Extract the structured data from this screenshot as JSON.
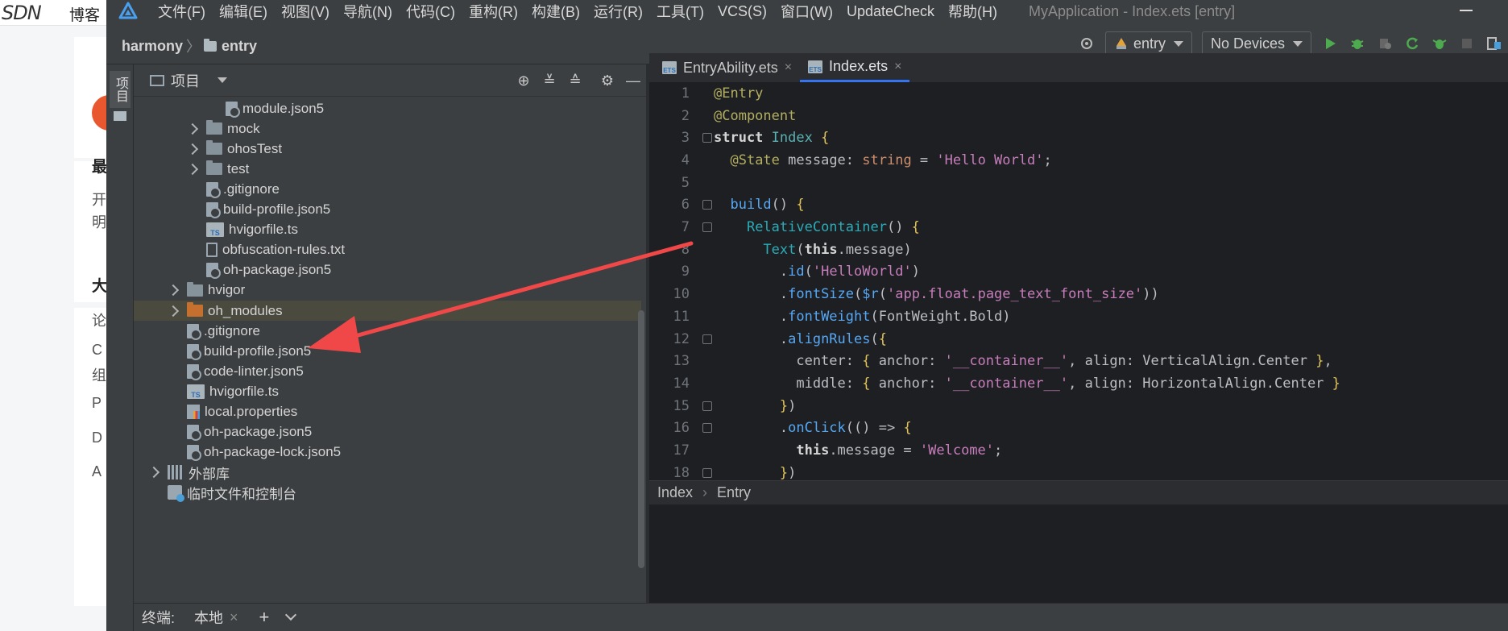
{
  "background": {
    "logo_text": "SDN",
    "blog_label": "博客",
    "chars": [
      "最",
      "开",
      "明",
      "大",
      "论",
      "C",
      "组",
      "P",
      "D",
      "A"
    ]
  },
  "menubar": {
    "items": [
      "文件(F)",
      "编辑(E)",
      "视图(V)",
      "导航(N)",
      "代码(C)",
      "重构(R)",
      "构建(B)",
      "运行(R)",
      "工具(T)",
      "VCS(S)",
      "窗口(W)",
      "UpdateCheck",
      "帮助(H)"
    ],
    "window_title": "MyApplication - Index.ets [entry]"
  },
  "navbar": {
    "breadcrumb": [
      "harmony",
      "entry"
    ],
    "run_config": "entry",
    "device": "No Devices"
  },
  "tool_strip": {
    "label": "项目"
  },
  "project_panel": {
    "title": "项目",
    "tree": [
      {
        "label": "module.json5",
        "icon": "json-file",
        "indent": 3,
        "expandable": false
      },
      {
        "label": "mock",
        "icon": "folder",
        "indent": 2,
        "expandable": true
      },
      {
        "label": "ohosTest",
        "icon": "folder",
        "indent": 2,
        "expandable": true
      },
      {
        "label": "test",
        "icon": "folder",
        "indent": 2,
        "expandable": true
      },
      {
        "label": ".gitignore",
        "icon": "git-file",
        "indent": 2,
        "expandable": false
      },
      {
        "label": "build-profile.json5",
        "icon": "json-file",
        "indent": 2,
        "expandable": false
      },
      {
        "label": "hvigorfile.ts",
        "icon": "ts-file",
        "indent": 2,
        "expandable": false
      },
      {
        "label": "obfuscation-rules.txt",
        "icon": "text-file",
        "indent": 2,
        "expandable": false
      },
      {
        "label": "oh-package.json5",
        "icon": "json-file",
        "indent": 2,
        "expandable": false
      },
      {
        "label": "hvigor",
        "icon": "folder",
        "indent": 1,
        "expandable": true
      },
      {
        "label": "oh_modules",
        "icon": "folder-orange",
        "indent": 1,
        "expandable": true,
        "selected": true
      },
      {
        "label": ".gitignore",
        "icon": "git-file",
        "indent": 1,
        "expandable": false
      },
      {
        "label": "build-profile.json5",
        "icon": "json-file",
        "indent": 1,
        "expandable": false
      },
      {
        "label": "code-linter.json5",
        "icon": "json-file",
        "indent": 1,
        "expandable": false
      },
      {
        "label": "hvigorfile.ts",
        "icon": "ts-file",
        "indent": 1,
        "expandable": false
      },
      {
        "label": "local.properties",
        "icon": "properties-file",
        "indent": 1,
        "expandable": false
      },
      {
        "label": "oh-package.json5",
        "icon": "json-file",
        "indent": 1,
        "expandable": false
      },
      {
        "label": "oh-package-lock.json5",
        "icon": "json-file",
        "indent": 1,
        "expandable": false
      },
      {
        "label": "外部库",
        "icon": "library",
        "indent": 0,
        "expandable": true
      },
      {
        "label": "临时文件和控制台",
        "icon": "console",
        "indent": 0,
        "expandable": false
      }
    ]
  },
  "editor": {
    "tabs": [
      {
        "label": "EntryAbility.ets",
        "active": false
      },
      {
        "label": "Index.ets",
        "active": true
      }
    ],
    "code_lines": [
      {
        "n": "1",
        "html": "<span class='c-anno'>@Entry</span>"
      },
      {
        "n": "2",
        "html": "<span class='c-anno'>@Component</span>"
      },
      {
        "n": "3",
        "html": "<span class='c-kwb'>struct</span> <span class='c-green'>Index</span> <span class='c-yellow'>{</span>"
      },
      {
        "n": "4",
        "html": "  <span class='c-anno'>@State</span> message: <span class='c-kw'>string</span> = <span class='c-str2'>'Hello World'</span>;"
      },
      {
        "n": "5",
        "html": ""
      },
      {
        "n": "6",
        "html": "  <span class='c-fn'>build</span>() <span class='c-yellow'>{</span>"
      },
      {
        "n": "7",
        "html": "    <span class='c-teal'>RelativeContainer</span>() <span class='c-yellow'>{</span>"
      },
      {
        "n": "8",
        "html": "      <span class='c-teal'>Text</span>(<span class='c-kwb'>this</span>.message)"
      },
      {
        "n": "9",
        "html": "        .<span class='c-fn'>id</span>(<span class='c-str2'>'HelloWorld'</span>)"
      },
      {
        "n": "10",
        "html": "        .<span class='c-fn'>fontSize</span>(<span class='c-fn'>$r</span>(<span class='c-str2'>'app.float.page_text_font_size'</span>))"
      },
      {
        "n": "11",
        "html": "        .<span class='c-fn'>fontWeight</span>(FontWeight.Bold)"
      },
      {
        "n": "12",
        "html": "        .<span class='c-fn'>alignRules</span>(<span class='c-yellow'>{</span>"
      },
      {
        "n": "13",
        "html": "          center: <span class='c-yellow'>{</span> anchor: <span class='c-str2'>'__container__'</span>, align: VerticalAlign.Center <span class='c-yellow'>}</span>,"
      },
      {
        "n": "14",
        "html": "          middle: <span class='c-yellow'>{</span> anchor: <span class='c-str2'>'__container__'</span>, align: HorizontalAlign.Center <span class='c-yellow'>}</span>"
      },
      {
        "n": "15",
        "html": "        <span class='c-yellow'>}</span>)"
      },
      {
        "n": "16",
        "html": "        .<span class='c-fn'>onClick</span>(() =&gt; <span class='c-yellow'>{</span>"
      },
      {
        "n": "17",
        "html": "          <span class='c-kwb'>this</span>.message = <span class='c-str2'>'Welcome'</span>;"
      },
      {
        "n": "18",
        "html": "        <span class='c-yellow'>}</span>)"
      }
    ],
    "status_breadcrumb": [
      "Index",
      "Entry"
    ]
  },
  "bottom_bar": {
    "label": "终端:",
    "tab": "本地"
  },
  "colors": {
    "accent": "#3574f0",
    "arrow": "#f04848",
    "selection": "#4b4a3f"
  }
}
